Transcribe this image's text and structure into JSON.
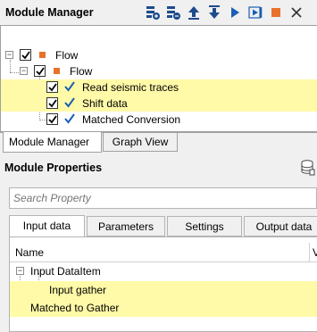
{
  "module_manager": {
    "title": "Module Manager",
    "toolbar": [
      {
        "name": "add-module-icon",
        "color": "#1e4b8c"
      },
      {
        "name": "remove-module-icon",
        "color": "#1e4b8c"
      },
      {
        "name": "move-up-icon",
        "color": "#1e4b8c"
      },
      {
        "name": "move-down-icon",
        "color": "#1e4b8c"
      },
      {
        "name": "run-icon",
        "color": "#1a5fb4"
      },
      {
        "name": "run-step-icon",
        "color": "#1a5fb4"
      },
      {
        "name": "stop-icon",
        "color": "#e8722c"
      },
      {
        "name": "close-icon",
        "color": "#333333"
      }
    ],
    "tree": [
      {
        "label": "Flow",
        "level": 0,
        "expander": "⊟",
        "checked": true,
        "icon": "orange-square",
        "highlight": false
      },
      {
        "label": "Flow",
        "level": 1,
        "expander": "⊟",
        "checked": true,
        "icon": "orange-square",
        "highlight": false
      },
      {
        "label": "Read seismic traces",
        "level": 2,
        "checked": true,
        "icon": "checkmark",
        "highlight": true
      },
      {
        "label": "Shift data",
        "level": 2,
        "checked": true,
        "icon": "checkmark",
        "highlight": true
      },
      {
        "label": "Matched Conversion",
        "level": 2,
        "checked": true,
        "icon": "checkmark",
        "highlight": false
      }
    ],
    "tabs": [
      "Module Manager",
      "Graph View"
    ],
    "active_tab": "Module Manager"
  },
  "module_properties": {
    "title": "Module Properties",
    "search_placeholder": "Search Property",
    "tabs": [
      "Input data",
      "Parameters",
      "Settings",
      "Output data"
    ],
    "active_tab": "Input data",
    "columns": [
      "Name",
      "V"
    ],
    "items": [
      {
        "label": "Input DataItem",
        "level": 0,
        "highlight": false
      },
      {
        "label": "Input gather",
        "level": 1,
        "highlight": true
      },
      {
        "label": "Matched to Gather",
        "level": 0,
        "highlight": true
      }
    ]
  },
  "colors": {
    "highlight": "#fffaa8",
    "accent_orange": "#e8722c",
    "check_blue": "#1a5fb4"
  }
}
